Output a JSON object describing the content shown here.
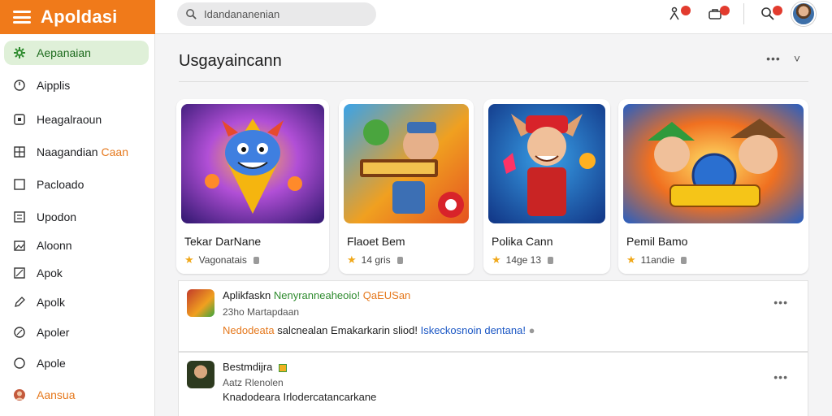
{
  "app": {
    "title": "Apoldasi"
  },
  "search": {
    "placeholder": "Idandananenian"
  },
  "topbar": {
    "icons": [
      {
        "name": "person-alert-icon",
        "badge": ""
      },
      {
        "name": "briefcase-icon",
        "badge": ""
      },
      {
        "name": "search-icon",
        "badge": ""
      }
    ]
  },
  "sidebar": {
    "items": [
      {
        "label": "Aepanaian",
        "icon": "gear-icon",
        "active": true
      },
      {
        "label": "Aipplis",
        "icon": "circle-icon"
      },
      {
        "label": "Heagalraoun",
        "icon": "square-icon"
      },
      {
        "label": "Naagandian",
        "accent": "Caan",
        "icon": "grid-icon"
      },
      {
        "label": "Pacloado",
        "icon": "box-icon"
      },
      {
        "label": "Upodon",
        "icon": "list-icon"
      },
      {
        "label": "Aloonn",
        "icon": "image-icon"
      },
      {
        "label": "Apok",
        "icon": "x-box-icon"
      },
      {
        "label": "Apolk",
        "icon": "pen-icon"
      },
      {
        "label": "Apoler",
        "icon": "leaf-icon"
      },
      {
        "label": "Apole",
        "icon": "circle-icon"
      },
      {
        "label": "Aansua",
        "icon": "avatar-icon"
      }
    ]
  },
  "main": {
    "title": "Usgayaincann",
    "actions": [
      "•••",
      "˅"
    ],
    "cards": [
      {
        "name": "Tekar DarNane",
        "meta": "Vagonatais"
      },
      {
        "name": "Flaoet Bem",
        "meta": "14 gris"
      },
      {
        "name": "Polika Cann",
        "meta": "14ge 13"
      },
      {
        "name": "Pemil Bamo",
        "meta": "11andie"
      }
    ],
    "posts": [
      {
        "author": "Aplikfaskn",
        "tag_green": "Nenyranneaheoio!",
        "tag_orange": "QaEUSan",
        "sub": "23ho Martapdaan",
        "body_orange": "Nedodeata",
        "body_main": "salcnealan Emakarkarin sliod!",
        "body_blue": "Iskeckosnoin dentana!",
        "more": "•••"
      },
      {
        "author": "Bestmdijra",
        "tag_green": "",
        "tag_orange": "",
        "sub": "Aatz Rlenolen",
        "body_orange": "",
        "body_main": "Knadodeara Irlodercatancarkane",
        "body_blue": "",
        "more": "•••"
      }
    ]
  },
  "colors": {
    "brand": "#f07a1a",
    "active_bg": "#dff0d8",
    "active_text": "#1e6b1e",
    "badge": "#e23b2e",
    "link_blue": "#1a56c4"
  }
}
